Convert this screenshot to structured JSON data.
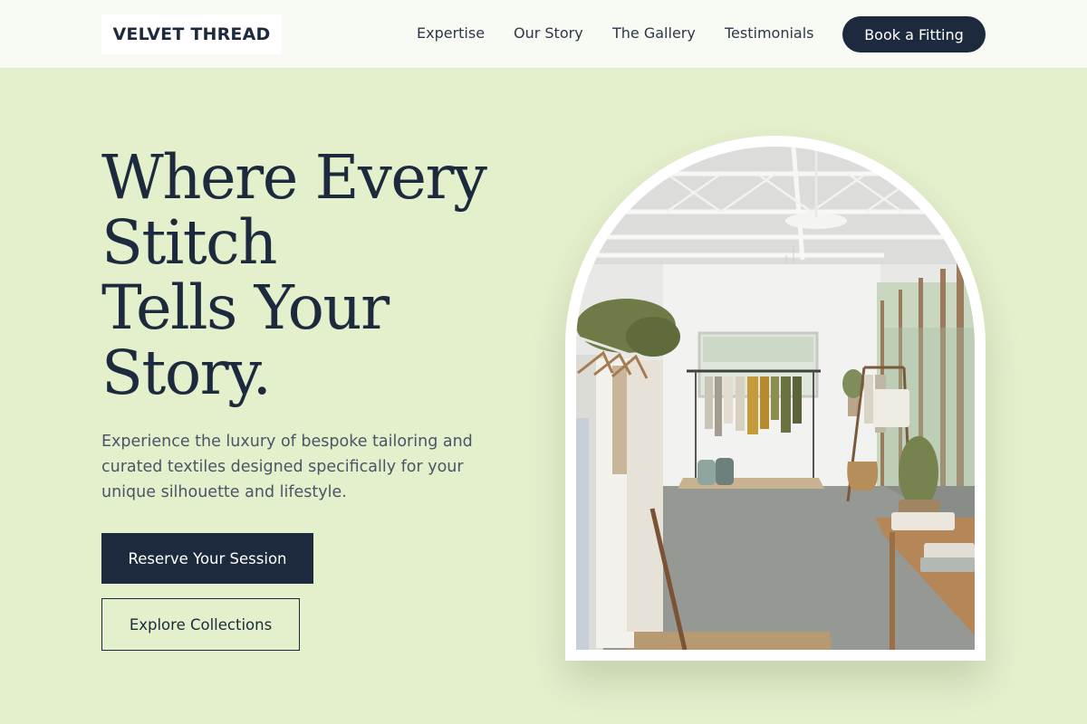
{
  "brand": {
    "logo_text": "VELVET THREAD"
  },
  "nav": {
    "links": [
      "Expertise",
      "Our Story",
      "The Gallery",
      "Testimonials"
    ],
    "cta": "Book a Fitting"
  },
  "hero": {
    "title_lines": [
      "Where Every",
      "Stitch",
      "Tells Your",
      "Story."
    ],
    "description": "Experience the luxury of bespoke tailoring and curated textiles designed specifically for your unique silhouette and lifestyle.",
    "primary_button": "Reserve Your Session",
    "secondary_button": "Explore Collections",
    "image_icon": "boutique-interior-photo"
  },
  "colors": {
    "background": "#e4efcc",
    "navbar": "#f8fbf3",
    "navy": "#1d2a3d",
    "body_text": "#4a5568"
  }
}
